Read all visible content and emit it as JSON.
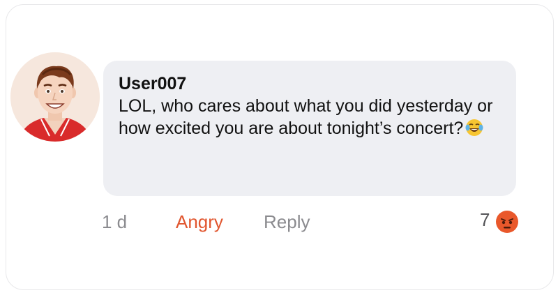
{
  "comment": {
    "username": "User007",
    "message": "LOL, who cares about what you did yesterday or how excited you are about tonight’s concert?",
    "inline_emoji": "laughing-tears-emoji"
  },
  "actions": {
    "time": "1 d",
    "angry_label": "Angry",
    "reply_label": "Reply"
  },
  "reactions": {
    "count": "7",
    "icon": "angry-face-icon",
    "color": "#e9582b"
  },
  "colors": {
    "bubble": "#eeeff3",
    "accent": "#e1562f",
    "muted": "#8b8b8f",
    "avatar_shirt": "#d92b2b"
  }
}
